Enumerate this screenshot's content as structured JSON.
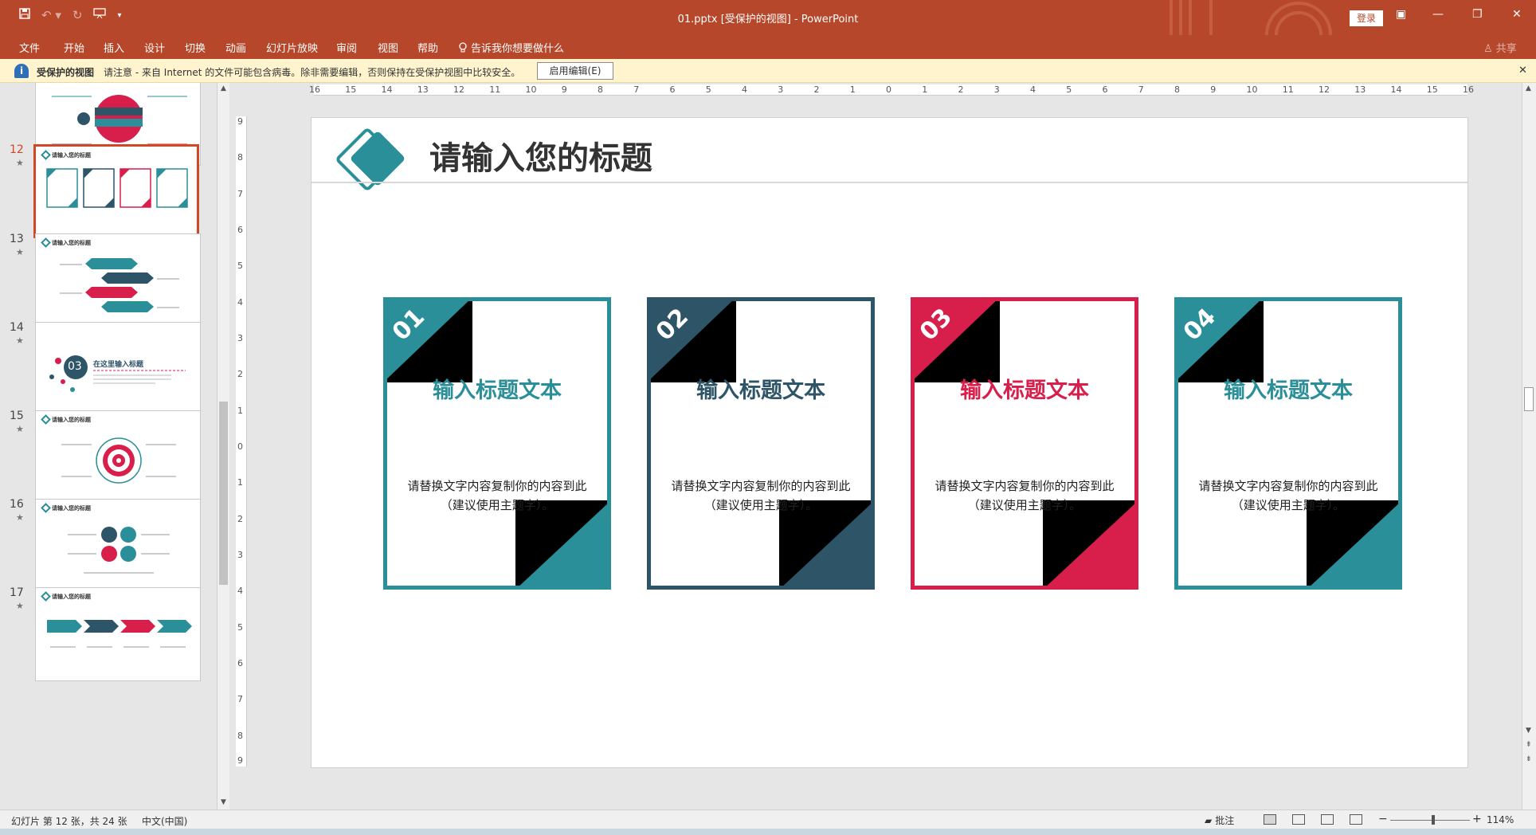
{
  "window": {
    "doc_title": "01.pptx [受保护的视图]  -  PowerPoint",
    "login_label": "登录",
    "share_label": "共享"
  },
  "qat": {
    "save_icon": "save-icon",
    "undo_icon": "undo-icon",
    "redo_icon": "redo-icon",
    "present_icon": "present-icon",
    "customize_icon": "customize-icon"
  },
  "ribbon": {
    "tabs": [
      "文件",
      "开始",
      "插入",
      "设计",
      "切换",
      "动画",
      "幻灯片放映",
      "审阅",
      "视图",
      "帮助"
    ],
    "tell_me": "告诉我你想要做什么"
  },
  "protected_bar": {
    "title": "受保护的视图",
    "message": "请注意 - 来自 Internet 的文件可能包含病毒。除非需要编辑，否则保持在受保护视图中比较安全。",
    "enable_button": "启用编辑(E)"
  },
  "thumbnails": [
    {
      "number": "",
      "title": ""
    },
    {
      "number": "12",
      "title": "请输入您的标题"
    },
    {
      "number": "13",
      "title": "请输入您的标题"
    },
    {
      "number": "14",
      "title": "在这里输入标题"
    },
    {
      "number": "15",
      "title": "请输入您的标题"
    },
    {
      "number": "16",
      "title": "请输入您的标题"
    },
    {
      "number": "17",
      "title": "请输入您的标题"
    }
  ],
  "thumb_14_badge": "03",
  "slide": {
    "title": "请输入您的标题",
    "cards": [
      {
        "number": "01",
        "title": "输入标题文本",
        "body": "请替换文字内容复制你的内容到此（建议使用主题字）。",
        "color": "#2b8f9a"
      },
      {
        "number": "02",
        "title": "输入标题文本",
        "body": "请替换文字内容复制你的内容到此（建议使用主题字）。",
        "color": "#2e5468"
      },
      {
        "number": "03",
        "title": "输入标题文本",
        "body": "请替换文字内容复制你的内容到此（建议使用主题字）。",
        "color": "#d81e4b"
      },
      {
        "number": "04",
        "title": "输入标题文本",
        "body": "请替换文字内容复制你的内容到此（建议使用主题字）。",
        "color": "#2b8f9a"
      }
    ]
  },
  "ruler": {
    "h_ticks": [
      "16",
      "15",
      "14",
      "13",
      "12",
      "11",
      "10",
      "9",
      "8",
      "7",
      "6",
      "5",
      "4",
      "3",
      "2",
      "1",
      "0",
      "1",
      "2",
      "3",
      "4",
      "5",
      "6",
      "7",
      "8",
      "9",
      "10",
      "11",
      "12",
      "13",
      "14",
      "15",
      "16"
    ],
    "v_ticks": [
      "9",
      "8",
      "7",
      "6",
      "5",
      "4",
      "3",
      "2",
      "1",
      "0",
      "1",
      "2",
      "3",
      "4",
      "5",
      "6",
      "7",
      "8",
      "9"
    ]
  },
  "status": {
    "slide_info": "幻灯片 第 12 张，共 24 张",
    "language": "中文(中国)",
    "notes_label": "批注",
    "zoom": "114%"
  }
}
